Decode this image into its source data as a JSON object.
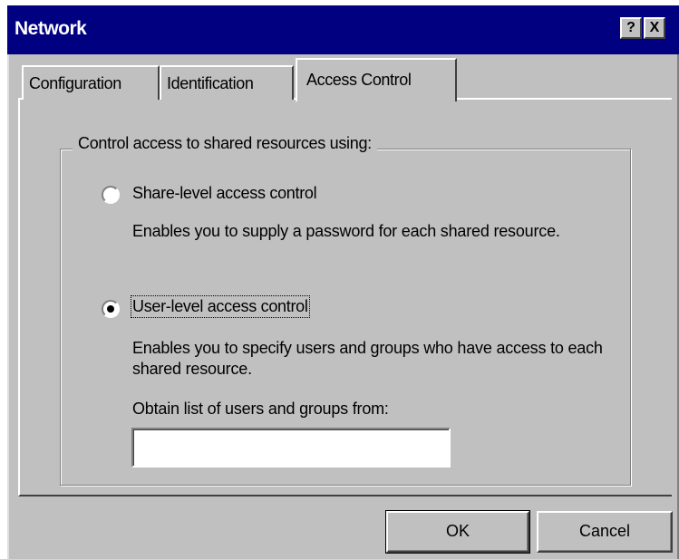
{
  "window": {
    "title": "Network",
    "help_label": "?",
    "close_label": "X"
  },
  "tabs": [
    {
      "label": "Configuration",
      "selected": false
    },
    {
      "label": "Identification",
      "selected": false
    },
    {
      "label": "Access Control",
      "selected": true
    }
  ],
  "access_control": {
    "group_label": "Control access to shared resources using:",
    "options": [
      {
        "label": "Share-level access control",
        "description": "Enables you to supply a password for each shared resource.",
        "selected": false
      },
      {
        "label": "User-level access control",
        "description": "Enables you to specify users and groups who have access to each shared resource.",
        "selected": true
      }
    ],
    "obtain_label": "Obtain list of users and groups from:",
    "obtain_value": ""
  },
  "buttons": {
    "ok": "OK",
    "cancel": "Cancel"
  }
}
